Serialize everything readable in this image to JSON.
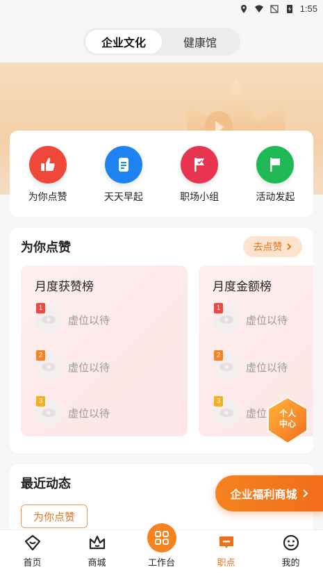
{
  "status_bar": {
    "time": "1:55"
  },
  "top_tabs": [
    {
      "label": "企业文化",
      "active": true
    },
    {
      "label": "健康馆",
      "active": false
    }
  ],
  "quick_actions": [
    {
      "label": "为你点赞",
      "icon": "thumbs-up-icon",
      "color": "#f0473b"
    },
    {
      "label": "天天早起",
      "icon": "document-icon",
      "color": "#1e82f0"
    },
    {
      "label": "职场小组",
      "icon": "flag-check-icon",
      "color": "#e8344f"
    },
    {
      "label": "活动发起",
      "icon": "flag-icon",
      "color": "#1fba55"
    }
  ],
  "praise_section": {
    "title": "为你点赞",
    "go_button": "去点赞",
    "boards": [
      {
        "title": "月度获赞榜",
        "items": [
          {
            "rank": "1",
            "name": "虚位以待"
          },
          {
            "rank": "2",
            "name": "虚位以待"
          },
          {
            "rank": "3",
            "name": "虚位以待"
          }
        ]
      },
      {
        "title": "月度金额榜",
        "items": [
          {
            "rank": "1",
            "name": "虚位以待"
          },
          {
            "rank": "2",
            "name": "虚位以待"
          },
          {
            "rank": "3",
            "name": "虚位以待"
          }
        ]
      }
    ]
  },
  "personal_center": {
    "line1": "个人",
    "line2": "中心"
  },
  "recent_section": {
    "title": "最近动态",
    "chip": "为你点赞"
  },
  "mall_button": {
    "label": "企业福利商城"
  },
  "bottom_tabs": [
    {
      "label": "首页",
      "icon": "home-icon",
      "active": false
    },
    {
      "label": "商城",
      "icon": "crown-icon",
      "active": false
    },
    {
      "label": "工作台",
      "icon": "grid-icon",
      "active": false
    },
    {
      "label": "职点",
      "icon": "message-icon",
      "active": true
    },
    {
      "label": "我的",
      "icon": "smile-icon",
      "active": false
    }
  ],
  "colors": {
    "accent": "#f26d1c",
    "rank1": "#f0473b",
    "rank2": "#f5831f",
    "rank3": "#f2b01e"
  }
}
